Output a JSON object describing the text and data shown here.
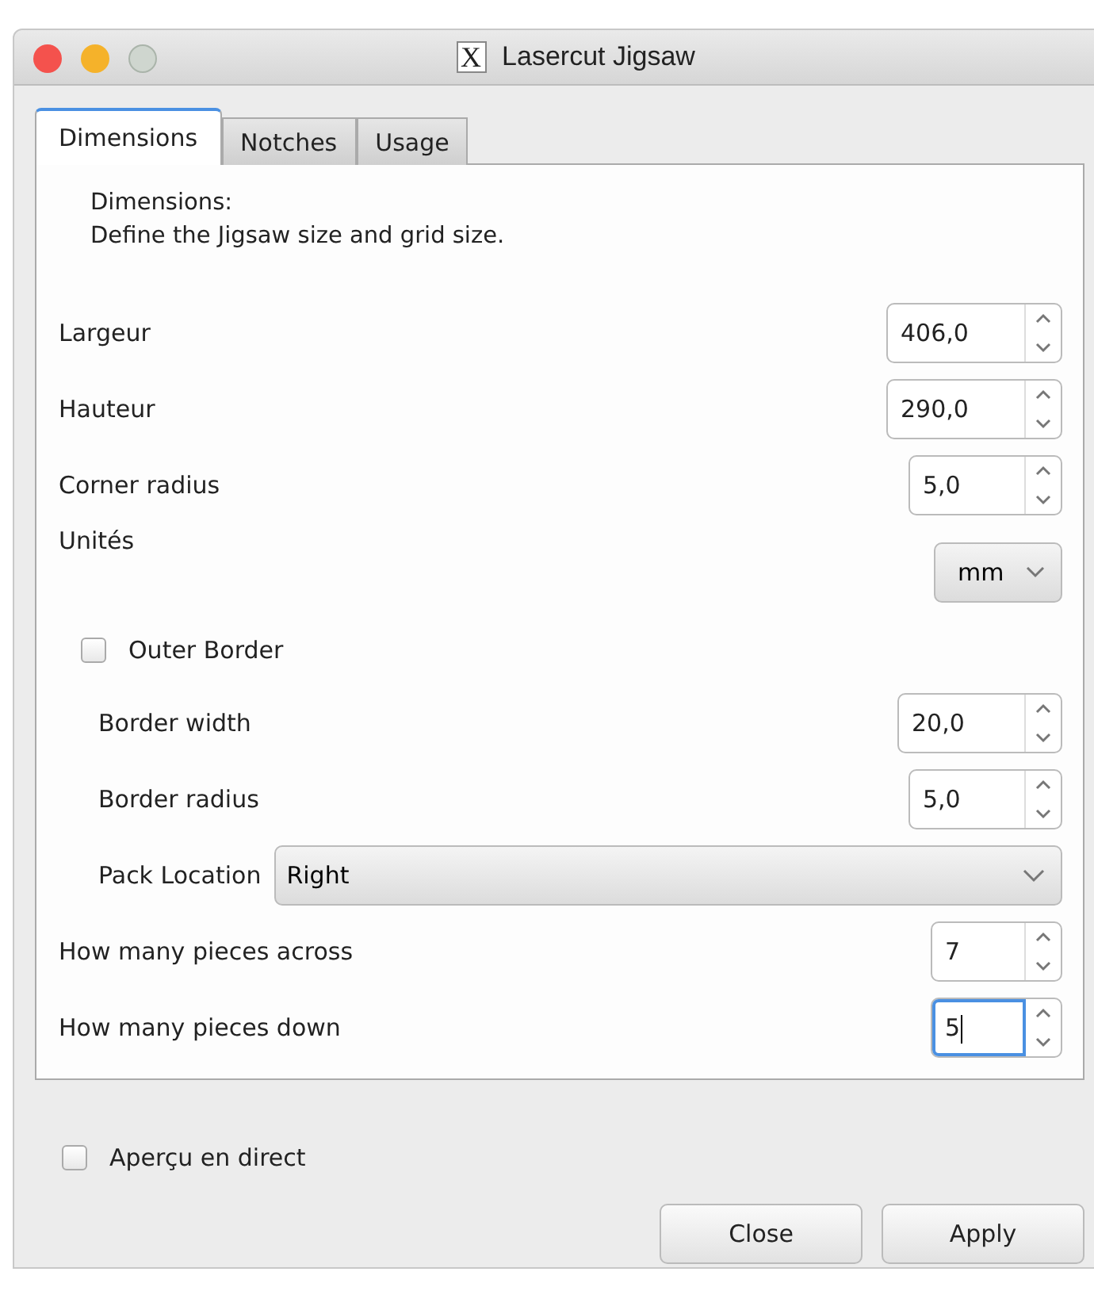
{
  "window": {
    "title": "Lasercut Jigsaw",
    "icon": "X"
  },
  "tabs": [
    {
      "label": "Dimensions",
      "selected": true
    },
    {
      "label": "Notches",
      "selected": false
    },
    {
      "label": "Usage",
      "selected": false
    }
  ],
  "description": {
    "heading": "Dimensions:",
    "text": "Define the Jigsaw size and grid size."
  },
  "rows": [
    {
      "kind": "spin",
      "label": "Largeur",
      "value": "406,0",
      "focused": false
    },
    {
      "kind": "spin",
      "label": "Hauteur",
      "value": "290,0",
      "focused": false
    },
    {
      "kind": "spin",
      "label": "Corner radius",
      "value": "5,0",
      "focused": false
    },
    {
      "kind": "select",
      "label": "Unités",
      "value": "mm"
    },
    {
      "kind": "checkbox",
      "label": "Outer Border",
      "checked": false,
      "children": [
        {
          "kind": "spin",
          "label": "Border width",
          "value": "20,0",
          "focused": false
        },
        {
          "kind": "spin",
          "label": "Border radius",
          "value": "5,0",
          "focused": false
        },
        {
          "kind": "wideselect",
          "label": "Pack Location",
          "value": "Right"
        }
      ]
    },
    {
      "kind": "spin",
      "label": "How many pieces across",
      "value": "7",
      "focused": false
    },
    {
      "kind": "spin",
      "label": "How many pieces down",
      "value": "5",
      "focused": true
    }
  ],
  "live_preview": {
    "label": "Aperçu en direct",
    "checked": false
  },
  "buttons": [
    "Close",
    "Apply"
  ]
}
